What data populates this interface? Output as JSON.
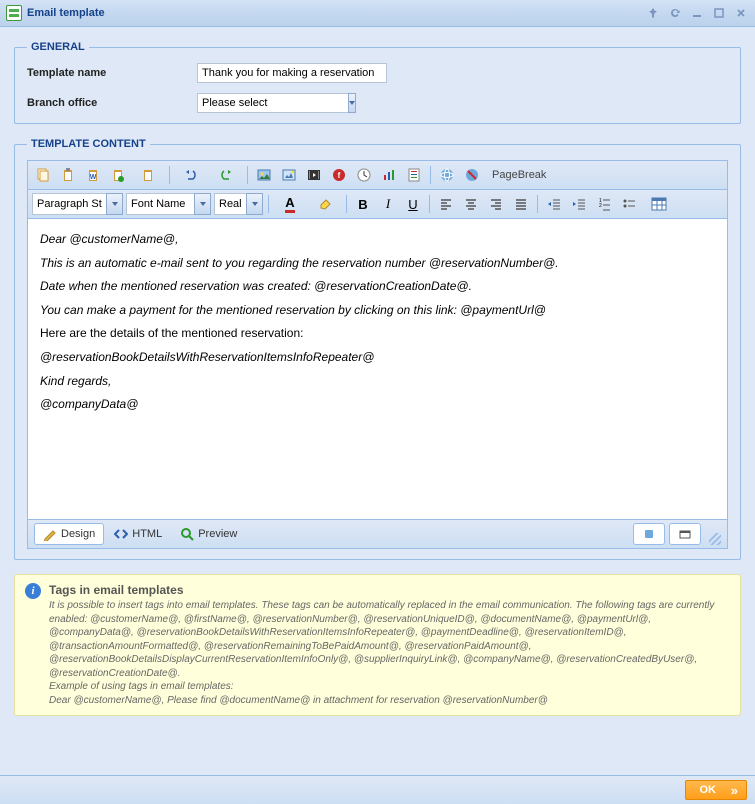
{
  "window": {
    "title": "Email template"
  },
  "general": {
    "legend": "GENERAL",
    "template_name_label": "Template name",
    "template_name_value": "Thank you for making a reservation",
    "branch_office_label": "Branch office",
    "branch_office_value": "Please select"
  },
  "template_content": {
    "legend": "TEMPLATE CONTENT",
    "para_style": "Paragraph St...",
    "font_name": "Font Name",
    "font_size": "Real...",
    "pagebreak_label": "PageBreak",
    "body_line1": "Dear @customerName@,",
    "body_line2": "This is an automatic e-mail sent to you regarding the reservation number @reservationNumber@.",
    "body_line3": "Date when the mentioned reservation was created: @reservationCreationDate@.",
    "body_line4": "You can make a payment for the mentioned reservation by clicking on this link: @paymentUrl@",
    "body_line5": "Here are the details of the mentioned reservation:",
    "body_line6": "@reservationBookDetailsWithReservationItemsInfoRepeater@",
    "body_line7": "Kind regards,",
    "body_line8": "@companyData@",
    "tabs": {
      "design": "Design",
      "html": "HTML",
      "preview": "Preview"
    }
  },
  "info": {
    "title": "Tags in email templates",
    "text1": "It is possible to insert tags into email templates. These tags can be automatically replaced in the email communication. The following tags are currently enabled: @customerName@, @firstName@, @reservationNumber@, @reservationUniqueID@, @documentName@, @paymentUrl@, @companyData@, @reservationBookDetailsWithReservationItemsInfoRepeater@, @paymentDeadline@, @reservationItemID@, @transactionAmountFormatted@, @reservationRemainingToBePaidAmount@, @reservationPaidAmount@, @reservationBookDetailsDisplayCurrentReservationItemInfoOnly@, @supplierInquiryLink@, @companyName@, @reservationCreatedByUser@, @reservationCreationDate@.",
    "text2": "Example of using tags in email templates:",
    "text3": "Dear @customerName@, Please find @documentName@ in attachment for reservation @reservationNumber@"
  },
  "buttons": {
    "ok": "OK"
  }
}
